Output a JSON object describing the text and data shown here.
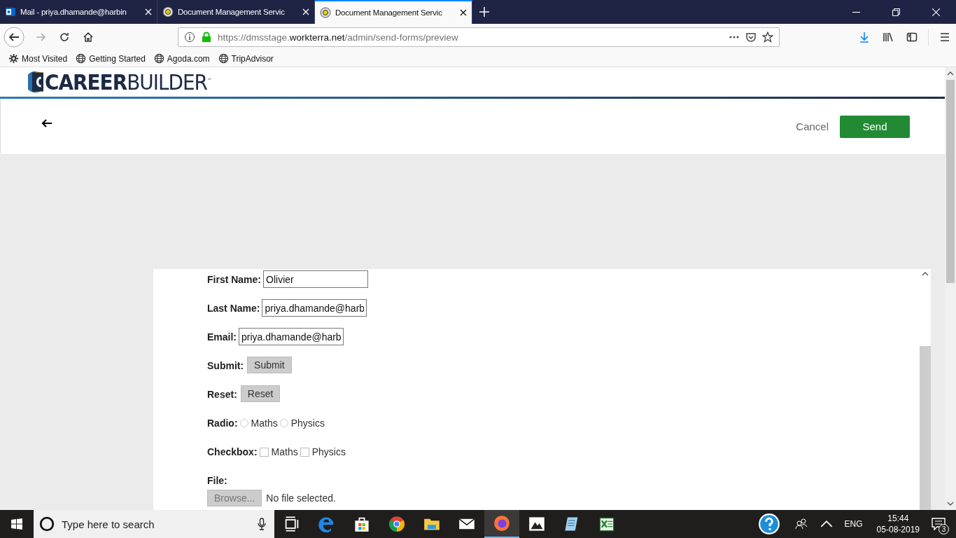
{
  "browser": {
    "tabs": [
      {
        "title": "Mail - priya.dhamande@harbin",
        "selected": false
      },
      {
        "title": "Document Management Servic",
        "selected": false
      },
      {
        "title": "Document Management Servic",
        "selected": true
      }
    ],
    "url": {
      "prefix": "https://dmsstage.",
      "domain": "workterra.net",
      "path": "/admin/send-forms/preview"
    },
    "bookmarks": [
      {
        "label": "Most Visited"
      },
      {
        "label": "Getting Started"
      },
      {
        "label": "Agoda.com"
      },
      {
        "label": "TripAdvisor"
      }
    ]
  },
  "header": {
    "logo": "**CAREER**BUILDER$^{™}$"
  },
  "actions": {
    "cancel": "Cancel",
    "send": "Send"
  },
  "form": {
    "fields": [
      {
        "kind": "text",
        "label": "First Name:",
        "value": "Olivier"
      },
      {
        "kind": "text",
        "label": "Last Name:",
        "value": "priya.dhamande@harb"
      },
      {
        "kind": "text",
        "label": "Email:",
        "value": "priya.dhamande@harb"
      },
      {
        "kind": "button",
        "label": "Submit:",
        "button": "Submit"
      },
      {
        "kind": "button",
        "label": "Reset:",
        "button": "Reset"
      },
      {
        "kind": "radio",
        "label": "Radio:",
        "options": [
          {
            "label": "Maths",
            "selected": false
          },
          {
            "label": "Physics",
            "selected": false
          }
        ]
      },
      {
        "kind": "checkbox",
        "label": "Checkbox:",
        "options": [
          {
            "label": "Maths",
            "checked": false
          },
          {
            "label": "Physics",
            "checked": false
          }
        ]
      },
      {
        "kind": "file",
        "label": "File:",
        "button": "Browse...",
        "status": "No file selected."
      }
    ]
  },
  "taskbar": {
    "search_placeholder": "Type here to search",
    "language": "ENG",
    "time": "15:44",
    "date": "05-08-2019",
    "notifications": "3"
  }
}
